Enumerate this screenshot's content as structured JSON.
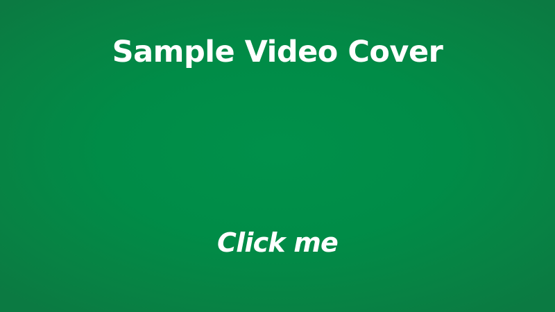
{
  "cover": {
    "title": "Sample Video Cover",
    "cta_label": "Click me",
    "background_color": "#008c47",
    "text_color": "#ffffff"
  }
}
